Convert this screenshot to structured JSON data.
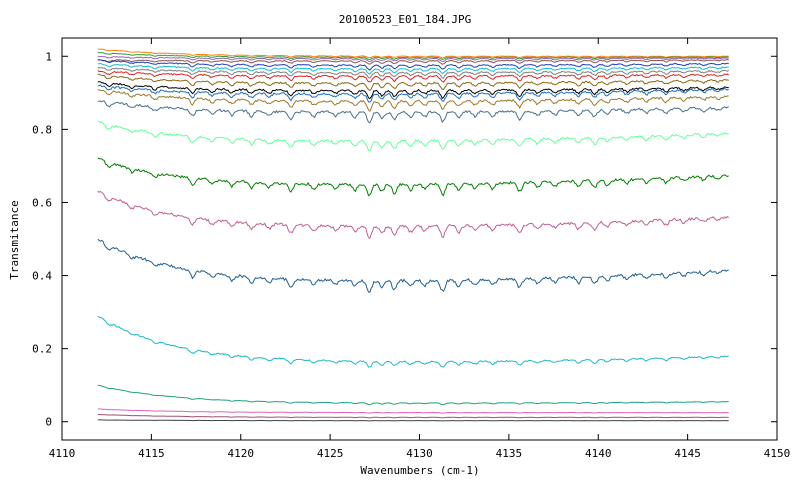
{
  "chart_data": {
    "type": "line",
    "title": "20100523_E01_184.JPG",
    "xlabel": "Wavenumbers (cm-1)",
    "ylabel": "Transmitance",
    "xlim": [
      4110,
      4150
    ],
    "ylim": [
      -0.05,
      1.05
    ],
    "x_ticks": [
      4110,
      4115,
      4120,
      4125,
      4130,
      4135,
      4140,
      4145,
      4150
    ],
    "x_tick_labels": [
      "4110",
      "4115",
      "4120",
      "4125",
      "4130",
      "4135",
      "4140",
      "4145",
      "4150"
    ],
    "y_ticks": [
      0,
      0.2,
      0.4,
      0.6,
      0.8,
      1
    ],
    "y_tick_labels": [
      "0",
      "0.2",
      "0.4",
      "0.6",
      "0.8",
      "1"
    ],
    "grid": false,
    "legend": "none",
    "x_range": [
      4112,
      4147.3
    ],
    "series": [
      {
        "color": "#ff7f0e",
        "start": 1.02,
        "base": 1.0,
        "end": 1.0,
        "absorb": 0.003
      },
      {
        "color": "#2ca02c",
        "start": 1.01,
        "base": 0.997,
        "end": 0.998,
        "absorb": 0.004
      },
      {
        "color": "#9467bd",
        "start": 1.0,
        "base": 0.993,
        "end": 0.995,
        "absorb": 0.005
      },
      {
        "color": "#8c564b",
        "start": 0.99,
        "base": 0.987,
        "end": 0.99,
        "absorb": 0.006
      },
      {
        "color": "#1f3fbf",
        "start": 0.99,
        "base": 0.975,
        "end": 0.98,
        "absorb": 0.008
      },
      {
        "color": "#17becf",
        "start": 0.98,
        "base": 0.965,
        "end": 0.97,
        "absorb": 0.009
      },
      {
        "color": "#7f7f7f",
        "start": 0.97,
        "base": 0.955,
        "end": 0.96,
        "absorb": 0.01
      },
      {
        "color": "#d62728",
        "start": 0.96,
        "base": 0.945,
        "end": 0.95,
        "absorb": 0.011
      },
      {
        "color": "#8b6914",
        "start": 0.95,
        "base": 0.925,
        "end": 0.935,
        "absorb": 0.012
      },
      {
        "color": "#000000",
        "start": 0.93,
        "base": 0.905,
        "end": 0.915,
        "absorb": 0.014
      },
      {
        "color": "#1f6fbf",
        "start": 0.92,
        "base": 0.895,
        "end": 0.91,
        "absorb": 0.015
      },
      {
        "color": "#9b7a2a",
        "start": 0.91,
        "base": 0.875,
        "end": 0.89,
        "absorb": 0.016
      },
      {
        "color": "#4a708b",
        "start": 0.88,
        "base": 0.845,
        "end": 0.86,
        "absorb": 0.018
      },
      {
        "color": "#66ff99",
        "start": 0.82,
        "base": 0.765,
        "end": 0.79,
        "absorb": 0.018
      },
      {
        "color": "#008000",
        "start": 0.72,
        "base": 0.645,
        "end": 0.675,
        "absorb": 0.02
      },
      {
        "color": "#c06090",
        "start": 0.63,
        "base": 0.53,
        "end": 0.56,
        "absorb": 0.02
      },
      {
        "color": "#1f5f8f",
        "start": 0.5,
        "base": 0.38,
        "end": 0.415,
        "absorb": 0.02
      },
      {
        "color": "#20b8c8",
        "start": 0.29,
        "base": 0.16,
        "end": 0.18,
        "absorb": 0.01
      },
      {
        "color": "#20a080",
        "start": 0.1,
        "base": 0.05,
        "end": 0.055,
        "absorb": 0.003
      },
      {
        "color": "#e060c0",
        "start": 0.035,
        "base": 0.025,
        "end": 0.025,
        "absorb": 0.001
      },
      {
        "color": "#a05070",
        "start": 0.02,
        "base": 0.012,
        "end": 0.012,
        "absorb": 0.001
      },
      {
        "color": "#404040",
        "start": 0.005,
        "base": 0.003,
        "end": 0.003,
        "absorb": 0.0005
      }
    ]
  }
}
